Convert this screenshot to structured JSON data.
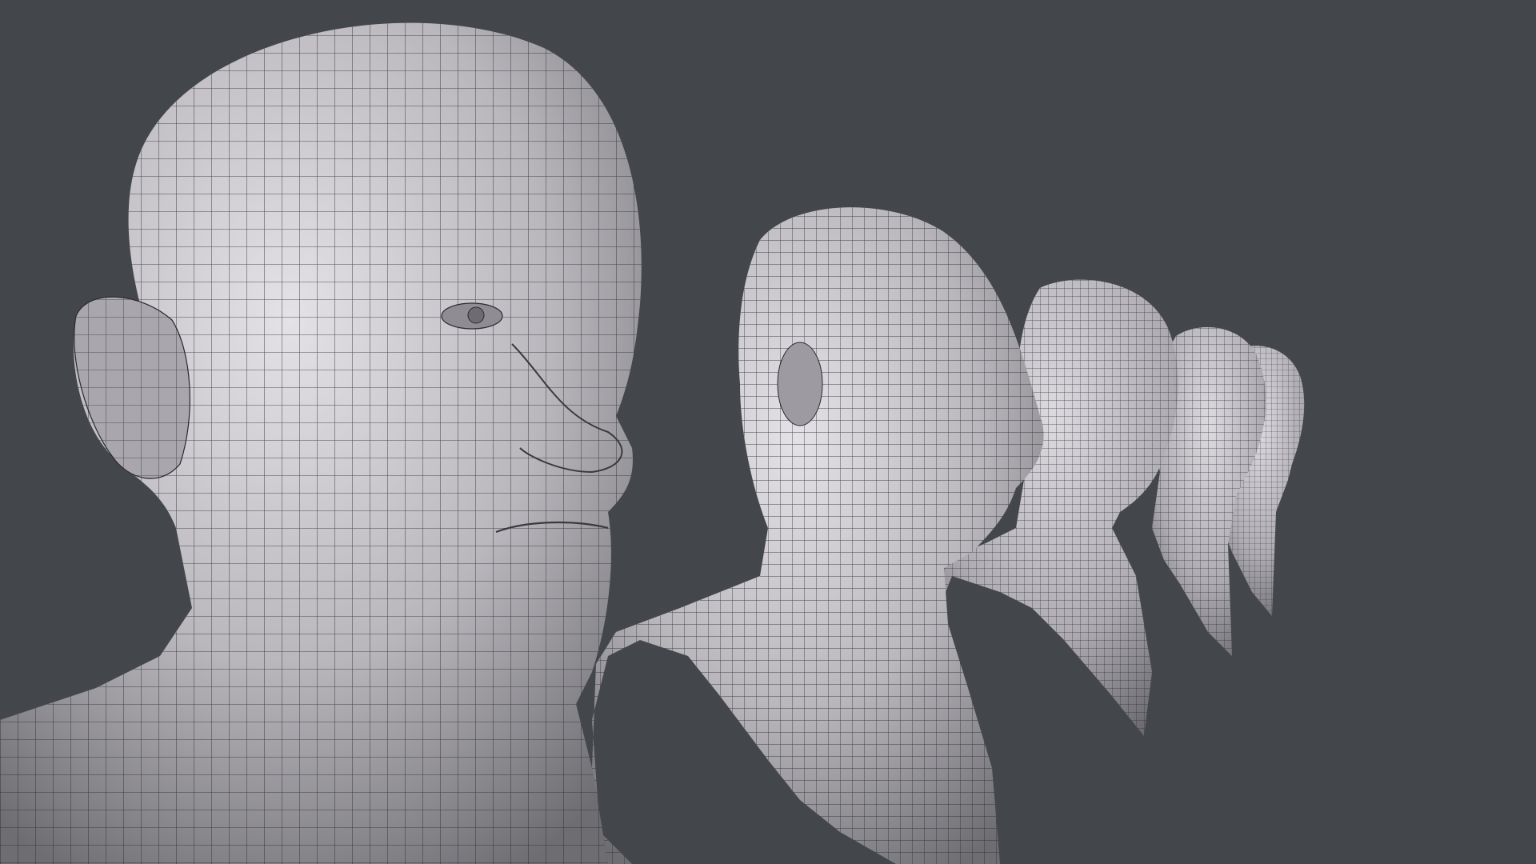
{
  "scene": {
    "background_color": "#43474c",
    "mesh_surface_color": "#c9c7cb",
    "wire_color": "#2a2a2e",
    "subject": "wireframe-head-busts",
    "bust_count": 5
  }
}
